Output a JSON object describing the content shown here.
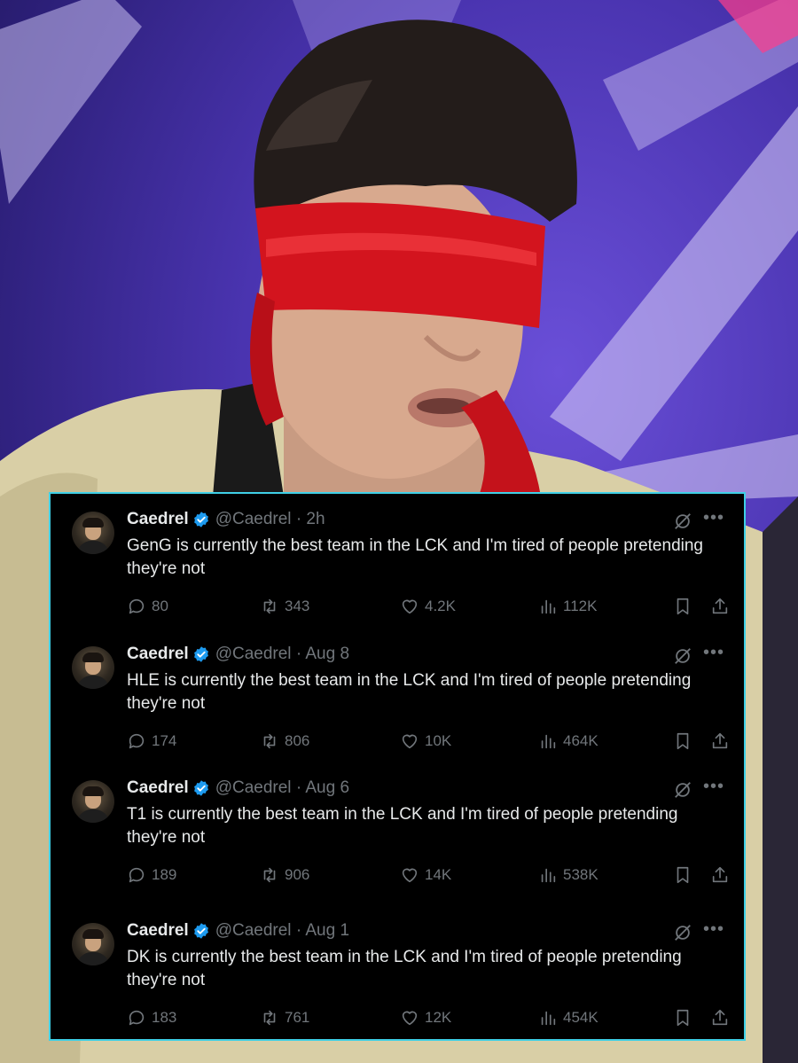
{
  "colors": {
    "card_background": "#000000",
    "card_border": "#3fd0e6",
    "text_primary": "#e7e9ea",
    "text_secondary": "#71767b",
    "verified_badge": "#1d9bf0",
    "blindfold": "#d3141e",
    "background": "#4a34b0"
  },
  "icons": [
    "verified-badge-icon",
    "grok-icon",
    "more-icon",
    "reply-icon",
    "retweet-icon",
    "like-icon",
    "views-icon",
    "bookmark-icon",
    "share-icon"
  ],
  "tweets": [
    {
      "name": "Caedrel",
      "handle": "@Caedrel",
      "time": "· 2h",
      "text": "GenG is currently the best team in the LCK and I'm tired of people pretending they're not",
      "replies": "80",
      "retweets": "343",
      "likes": "4.2K",
      "views": "112K"
    },
    {
      "name": "Caedrel",
      "handle": "@Caedrel",
      "time": "· Aug 8",
      "text": "HLE is currently the best team in the LCK and I'm tired of people pretending they're not",
      "replies": "174",
      "retweets": "806",
      "likes": "10K",
      "views": "464K"
    },
    {
      "name": "Caedrel",
      "handle": "@Caedrel",
      "time": "· Aug 6",
      "text": "T1 is currently the best team in the LCK and I'm tired of people pretending they're not",
      "replies": "189",
      "retweets": "906",
      "likes": "14K",
      "views": "538K"
    },
    {
      "name": "Caedrel",
      "handle": "@Caedrel",
      "time": "· Aug 1",
      "text": "DK is currently the best team in the LCK and I'm tired of people pretending they're not",
      "replies": "183",
      "retweets": "761",
      "likes": "12K",
      "views": "454K"
    }
  ]
}
